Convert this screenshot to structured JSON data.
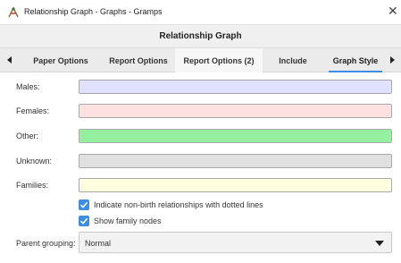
{
  "window": {
    "title": "Relationship Graph - Graphs - Gramps",
    "close_glyph": "✕",
    "icon": "gramps-app-icon"
  },
  "dialog": {
    "title": "Relationship Graph"
  },
  "tabs": {
    "items": [
      {
        "label": "Paper Options"
      },
      {
        "label": "Report Options"
      },
      {
        "label": "Report Options (2)"
      },
      {
        "label": "Include"
      },
      {
        "label": "Graph Style"
      }
    ],
    "active_index": 4,
    "scroll_left_icon": "triangle-left-icon",
    "scroll_right_icon": "triangle-right-icon"
  },
  "colors": {
    "rows": [
      {
        "label": "Males:",
        "color": "#e0e0ff"
      },
      {
        "label": "Females:",
        "color": "#ffe0e0"
      },
      {
        "label": "Other:",
        "color": "#94ef9e"
      },
      {
        "label": "Unknown:",
        "color": "#e0e0e0"
      },
      {
        "label": "Families:",
        "color": "#ffffe0"
      }
    ]
  },
  "checks": {
    "dotted": {
      "label": "Indicate non-birth relationships with dotted lines",
      "checked": true
    },
    "family_nodes": {
      "label": "Show family nodes",
      "checked": true
    }
  },
  "parent_grouping": {
    "label": "Parent grouping:",
    "value": "Normal"
  },
  "accent": "#3d8ee2"
}
